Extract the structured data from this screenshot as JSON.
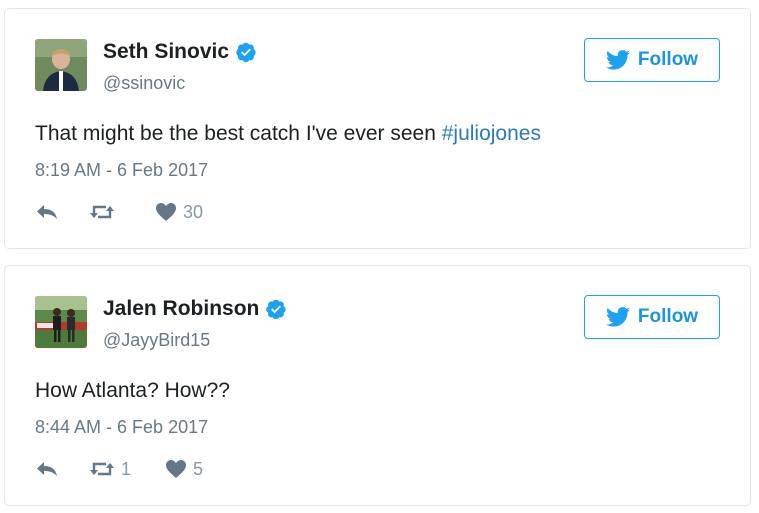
{
  "tweets": [
    {
      "display_name": "Seth Sinovic",
      "handle": "@ssinovic",
      "follow_label": "Follow",
      "text_plain": "That might be the best catch I've ever seen ",
      "hashtag": "#juliojones",
      "timestamp": "8:19 AM - 6 Feb 2017",
      "retweet_count": "",
      "like_count": "30",
      "verified": true
    },
    {
      "display_name": "Jalen Robinson",
      "handle": "@JayyBird15",
      "follow_label": "Follow",
      "text_plain": "How Atlanta? How??",
      "hashtag": "",
      "timestamp": "8:44 AM - 6 Feb 2017",
      "retweet_count": "1",
      "like_count": "5",
      "verified": true
    }
  ],
  "icons": {
    "reply": "reply-icon",
    "retweet": "retweet-icon",
    "like": "heart-icon",
    "verified": "verified-badge-icon",
    "bird": "twitter-bird-icon"
  },
  "colors": {
    "brand_blue": "#1da1f2",
    "link_blue": "#2b7bb9",
    "muted_gray": "#697882",
    "icon_gray": "#8899a6"
  }
}
